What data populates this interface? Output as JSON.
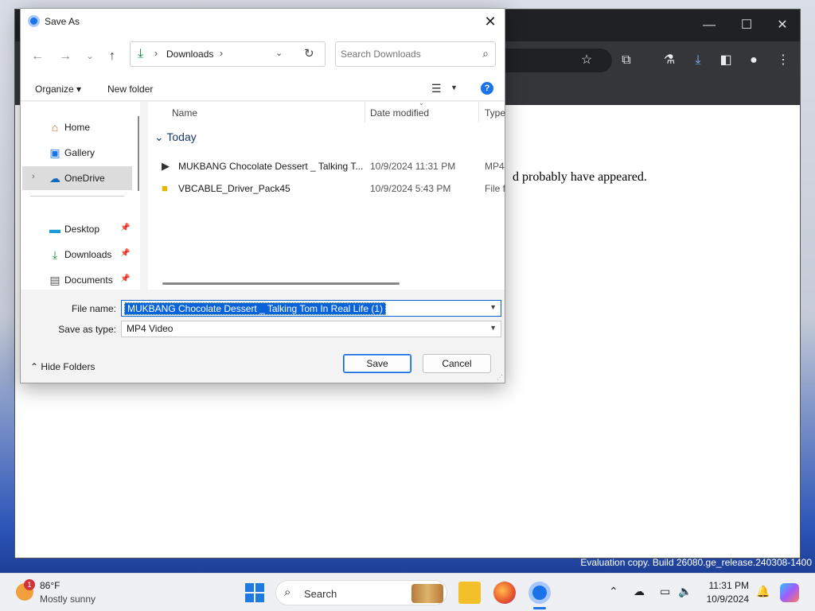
{
  "browser": {
    "page_text": "d probably have appeared.",
    "eval_text": "Evaluation copy. Build 26080.ge_release.240308-1400"
  },
  "dialog": {
    "title": "Save As",
    "nav": {
      "back_icon": "arrow-left-icon",
      "forward_icon": "arrow-right-icon",
      "recent_icon": "chevron-down-icon",
      "up_icon": "arrow-up-icon",
      "address_location": "Downloads",
      "search_placeholder": "Search Downloads"
    },
    "commands": {
      "organize": "Organize",
      "new_folder": "New folder"
    },
    "nav_pane": {
      "items": [
        {
          "label": "Home",
          "icon": "home-icon"
        },
        {
          "label": "Gallery",
          "icon": "gallery-icon"
        },
        {
          "label": "OneDrive",
          "icon": "cloud-icon",
          "selected": true
        },
        {
          "label": "Desktop",
          "icon": "desktop-icon",
          "pinned": true
        },
        {
          "label": "Downloads",
          "icon": "download-icon",
          "pinned": true
        },
        {
          "label": "Documents",
          "icon": "document-icon",
          "pinned": true
        }
      ]
    },
    "columns": {
      "name": "Name",
      "date": "Date modified",
      "type": "Type"
    },
    "group": "Today",
    "files": [
      {
        "name": "MUKBANG Chocolate Dessert _ Talking T...",
        "date": "10/9/2024 11:31 PM",
        "type": "MP4",
        "icon": "video-file-icon"
      },
      {
        "name": "VBCABLE_Driver_Pack45",
        "date": "10/9/2024 5:43 PM",
        "type": "File f",
        "icon": "folder-icon"
      }
    ],
    "file_name_label": "File name:",
    "file_name_value": "MUKBANG Chocolate Dessert _ Talking Tom In Real Life (1)",
    "save_type_label": "Save as type:",
    "save_type_value": "MP4 Video",
    "hide_folders": "Hide Folders",
    "save_button": "Save",
    "cancel_button": "Cancel"
  },
  "taskbar": {
    "weather_temp": "86°F",
    "weather_cond": "Mostly sunny",
    "weather_badge": "1",
    "search_label": "Search",
    "time": "11:31 PM",
    "date": "10/9/2024"
  },
  "colors": {
    "accent": "#0a64d8",
    "downloads_green": "#138a36"
  }
}
